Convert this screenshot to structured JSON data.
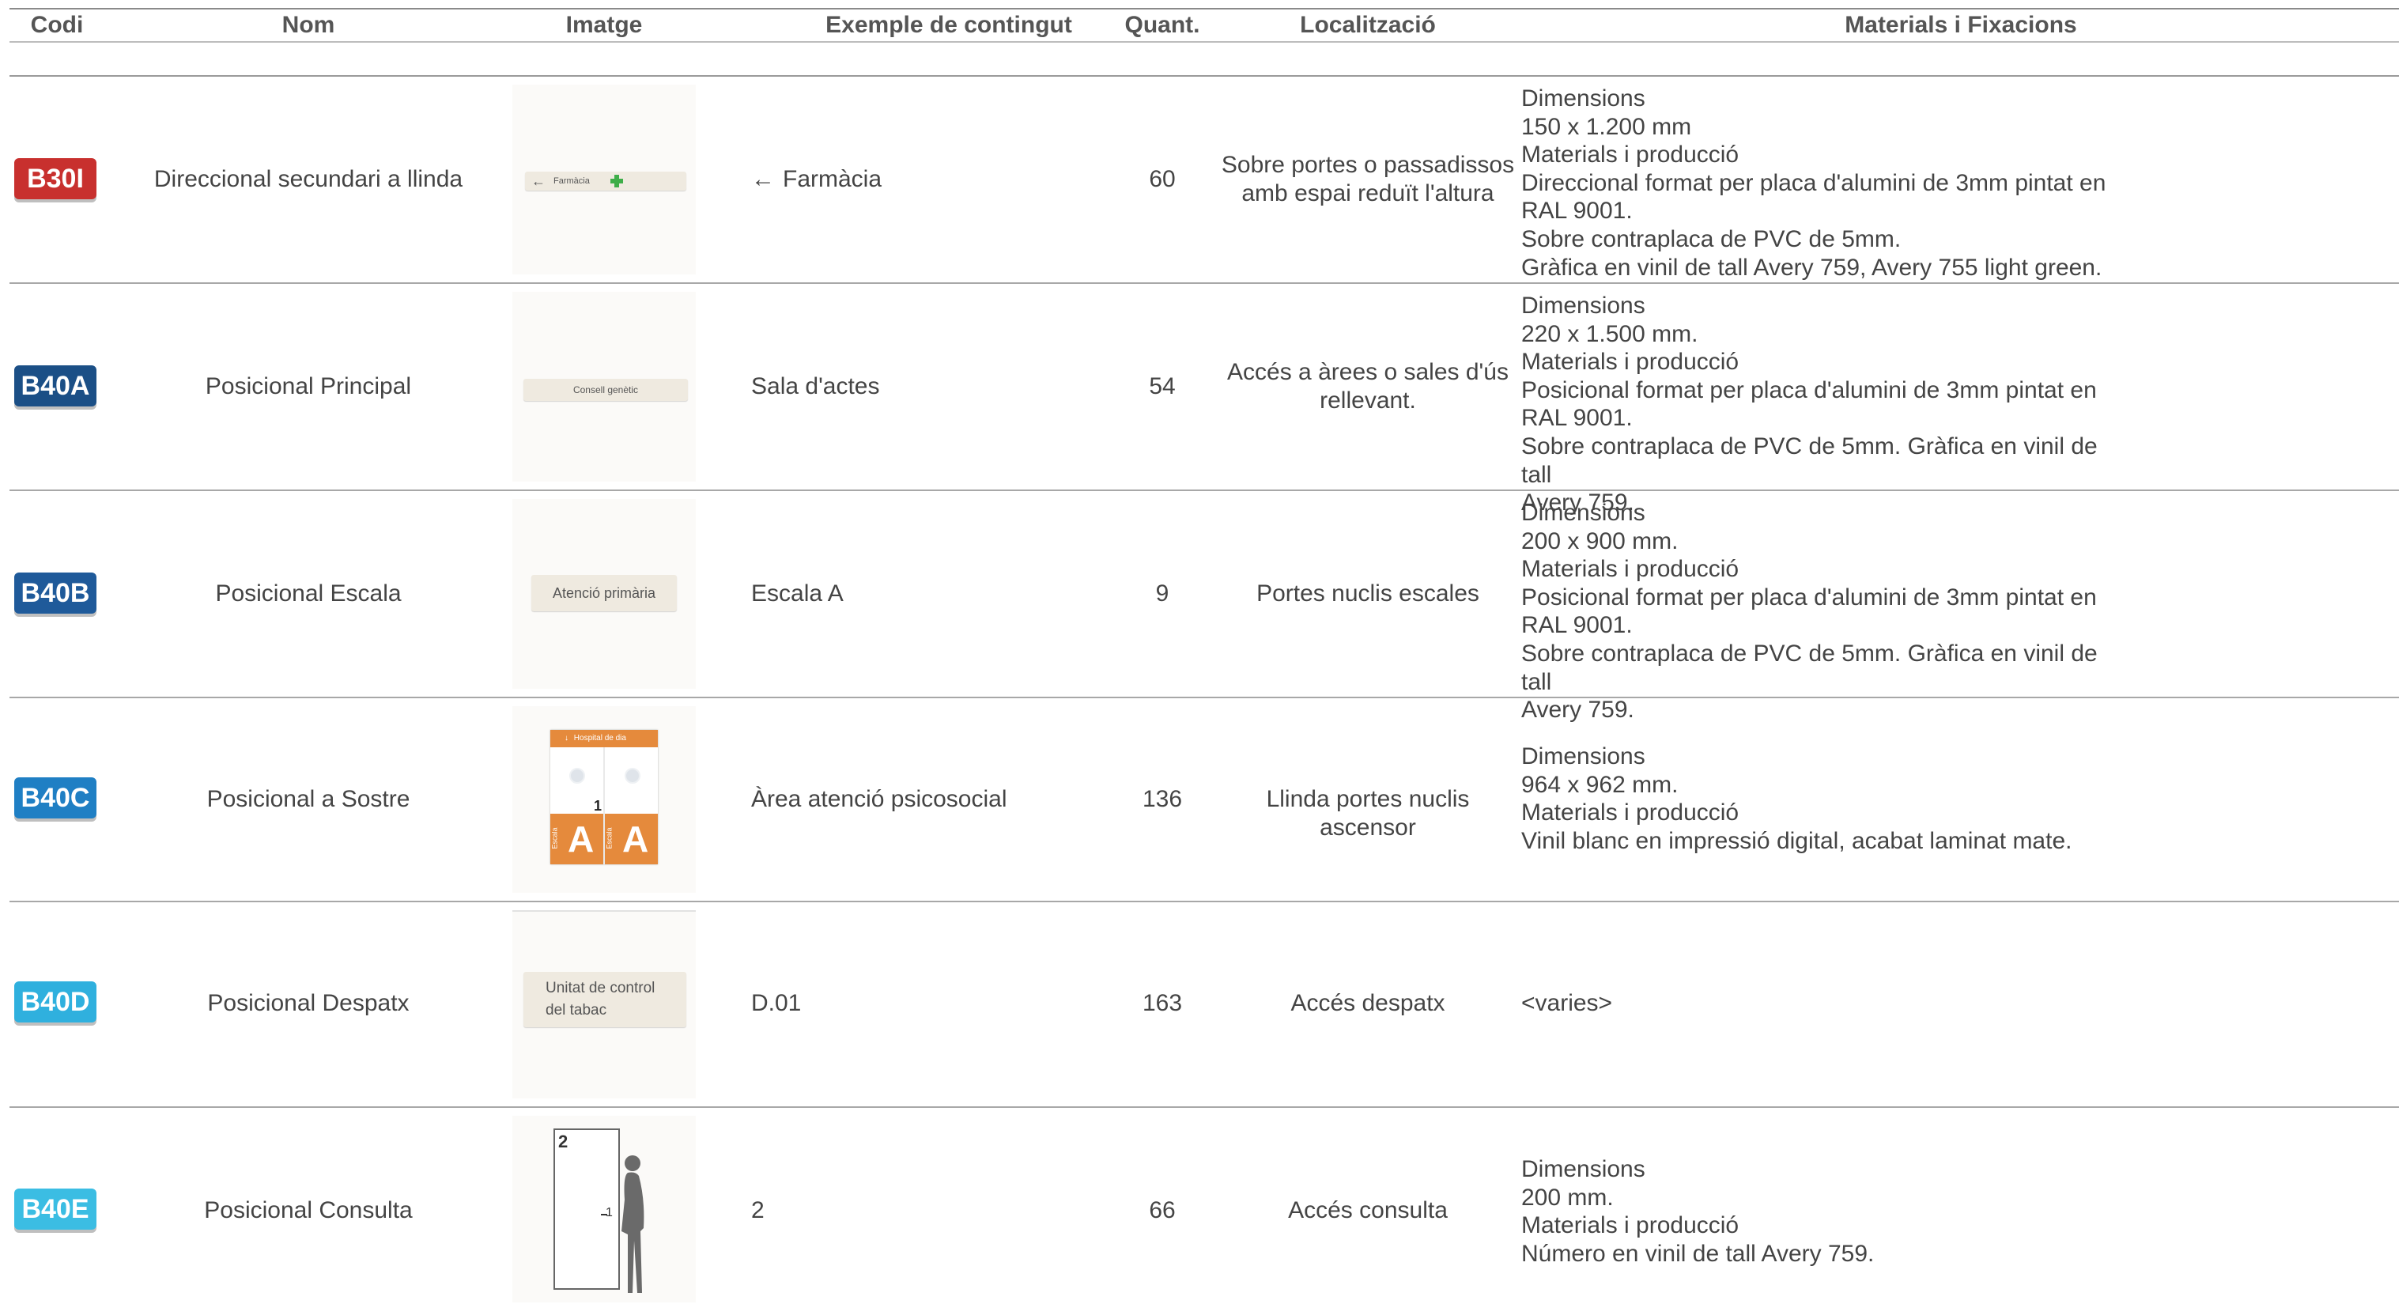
{
  "headers": {
    "codi": "Codi",
    "nom": "Nom",
    "imatge": "Imatge",
    "exemple": "Exemple de contingut",
    "quant": "Quant.",
    "localitzacio": "Localització",
    "materials": "Materials i Fixacions"
  },
  "colors": {
    "B30I": "#c8302e",
    "B40A": "#1b4f86",
    "B40B": "#1f5a9a",
    "B40C": "#1f7fc4",
    "B40D": "#2fb0de",
    "B40E": "#3bbde3",
    "orange_panel": "#e58a3c",
    "plate_bg": "#efeae0",
    "pharmacy_cross": "#3fae49"
  },
  "rows": [
    {
      "code": "B30I",
      "name": "Direccional secundari a llinda",
      "example": "Farmàcia",
      "example_icon": "arrow-left-icon",
      "qty": "60",
      "location": "Sobre portes o passadissos amb espai reduït l'altura",
      "materials": [
        "Dimensions",
        "150 x 1.200 mm",
        "Materials i producció",
        "Direccional format per placa d'alumini de 3mm pintat en",
        "RAL 9001.",
        "Sobre contraplaca de PVC de 5mm.",
        "Gràfica en vinil de tall Avery 759, Avery 755 light green."
      ],
      "image_text": "Farmàcia"
    },
    {
      "code": "B40A",
      "name": "Posicional Principal",
      "example": "Sala d'actes",
      "qty": "54",
      "location": "Accés a àrees o sales d'ús rellevant.",
      "materials": [
        "Dimensions",
        "220 x 1.500 mm.",
        "Materials i producció",
        "Posicional format per placa d'alumini de 3mm pintat en",
        "RAL 9001.",
        "Sobre contraplaca de PVC de 5mm. Gràfica en vinil de tall",
        "Avery 759."
      ],
      "image_text": "Consell genètic"
    },
    {
      "code": "B40B",
      "name": "Posicional Escala",
      "example": "Escala A",
      "qty": "9",
      "location": "Portes nuclis escales",
      "materials": [
        "Dimensions",
        "200 x 900 mm.",
        "Materials i producció",
        "Posicional format per placa d'alumini de 3mm pintat en",
        "RAL 9001.",
        "Sobre contraplaca de PVC de 5mm. Gràfica en vinil de tall",
        "Avery 759."
      ],
      "image_text": "Atenció primària"
    },
    {
      "code": "B40C",
      "name": "Posicional a Sostre",
      "example": "Àrea atenció psicosocial",
      "qty": "136",
      "location": "Llinda portes nuclis ascensor",
      "materials": [
        "Dimensions",
        "964 x 962 mm.",
        "Materials i producció",
        "Vinil blanc en impressió digital, acabat laminat mate."
      ],
      "image_text": "Hospital de dia",
      "image_big": "A",
      "image_small": "Escala",
      "image_num": "1"
    },
    {
      "code": "B40D",
      "name": "Posicional Despatx",
      "example": "D.01",
      "qty": "163",
      "location": "Accés despatx",
      "materials": [
        "<varies>"
      ],
      "image_text_lines": [
        "Unitat de control",
        "del tabac"
      ]
    },
    {
      "code": "B40E",
      "name": "Posicional Consulta",
      "example": "2",
      "qty": "66",
      "location": "Accés consulta",
      "materials": [
        "Dimensions",
        "200 mm.",
        "Materials i producció",
        "Número en vinil de tall Avery 759."
      ],
      "image_num": "2",
      "image_small_num": "1"
    }
  ]
}
